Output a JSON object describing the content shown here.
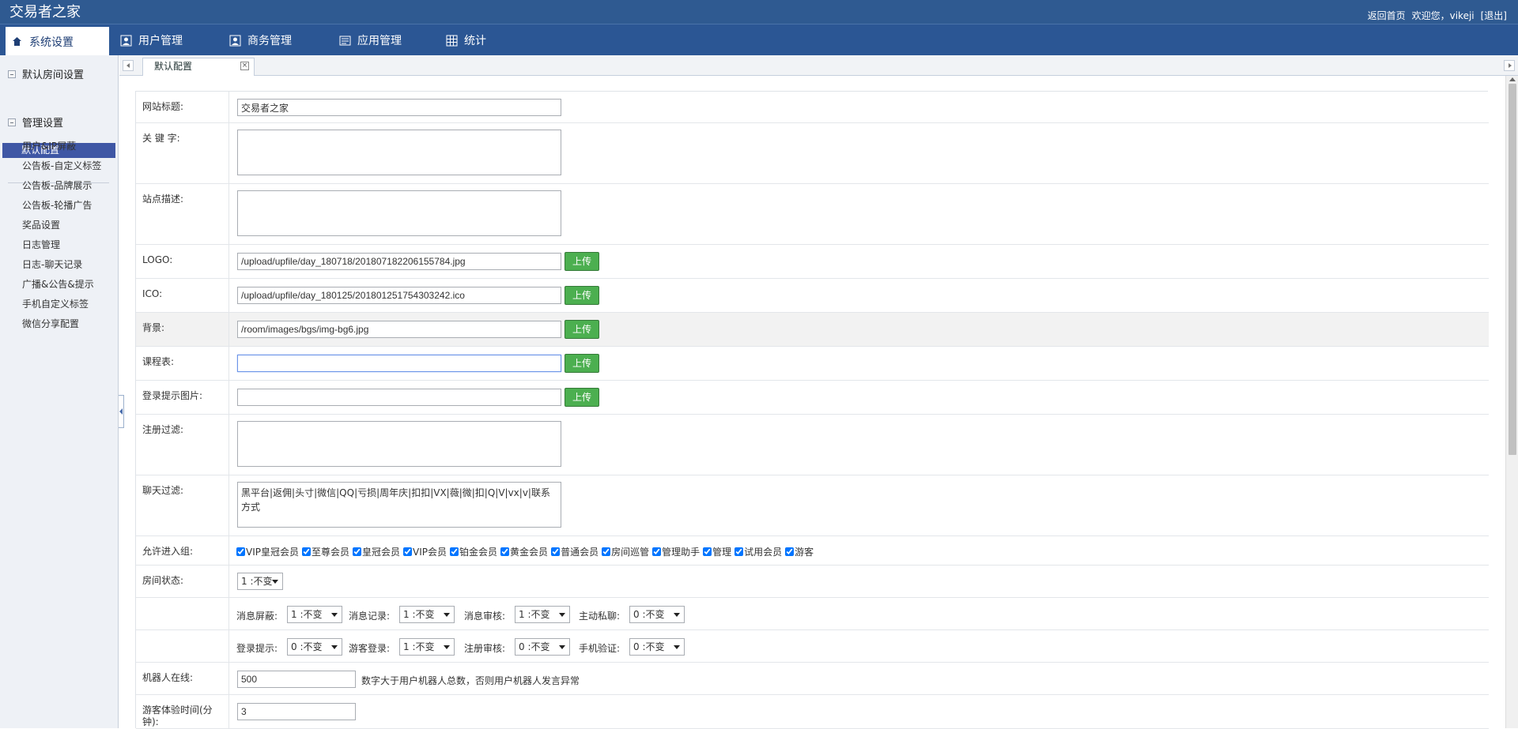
{
  "app": {
    "title": "交易者之家"
  },
  "top_right": {
    "home": "返回首页",
    "welcome": "欢迎您，",
    "user": "vikeji",
    "logout": "[退出]"
  },
  "nav": [
    {
      "label": "系统设置",
      "icon": "home-icon"
    },
    {
      "label": "用户管理",
      "icon": "user-icon"
    },
    {
      "label": "商务管理",
      "icon": "business-icon"
    },
    {
      "label": "应用管理",
      "icon": "app-icon"
    },
    {
      "label": "统计",
      "icon": "grid-icon"
    }
  ],
  "sidebar": {
    "group1": "默认房间设置",
    "active": "默认配置",
    "group2": "管理设置",
    "items": [
      "用户&IP屏蔽",
      "公告板-自定义标签",
      "公告板-品牌展示",
      "公告板-轮播广告",
      "奖品设置",
      "日志管理",
      "日志-聊天记录",
      "广播&公告&提示",
      "手机自定义标签",
      "微信分享配置"
    ]
  },
  "tab": {
    "label": "默认配置",
    "close": "×"
  },
  "form": {
    "site_title_label": "网站标题:",
    "site_title_value": "交易者之家",
    "keywords_label": "关 键 字:",
    "description_label": "站点描述:",
    "logo_label": "LOGO:",
    "logo_value": "/upload/upfile/day_180718/201807182206155784.jpg",
    "ico_label": "ICO:",
    "ico_value": "/upload/upfile/day_180125/201801251754303242.ico",
    "background_label": "背景:",
    "background_value": "/room/images/bgs/img-bg6.jpg",
    "schedule_label": "课程表:",
    "schedule_value": "",
    "login_image_label": "登录提示图片:",
    "login_image_value": "",
    "register_filter_label": "注册过滤:",
    "chat_filter_label": "聊天过滤:",
    "chat_filter_value": "黑平台|返佣|头寸|微信|QQ|亏损|周年庆|扣扣|VX|薇|微|扣|Q|V|vx|v|联系方式",
    "upload_label": "上传",
    "groups_label": "允许进入组:",
    "groups": [
      "VIP皇冠会员",
      "至尊会员",
      "皇冠会员",
      "VIP会员",
      "铂金会员",
      "黄金会员",
      "普通会员",
      "房间巡管",
      "管理助手",
      "管理",
      "试用会员",
      "游客"
    ],
    "room_status_label": "房间状态:",
    "room_status_value": "1 :不变",
    "message_block_label": "消息屏蔽:",
    "message_block_value": "1 :不变",
    "message_record_label": "消息记录:",
    "message_record_value": "1 :不变",
    "message_review_label": "消息审核:",
    "message_review_value": "1 :不变",
    "private_chat_label": "主动私聊:",
    "private_chat_value": "0 :不变",
    "login_hint_label": "登录提示:",
    "login_hint_value": "0 :不变",
    "guest_login_label": "游客登录:",
    "guest_login_value": "1 :不变",
    "register_review_label": "注册审核:",
    "register_review_value": "0 :不变",
    "phone_verify_label": "手机验证:",
    "phone_verify_value": "0 :不变",
    "robot_label": "机器人在线:",
    "robot_value": "500",
    "robot_hint": "数字大于用户机器人总数，否则用户机器人发言异常",
    "guest_time_label": "游客体验时间(分钟):",
    "guest_time_value": "3"
  }
}
